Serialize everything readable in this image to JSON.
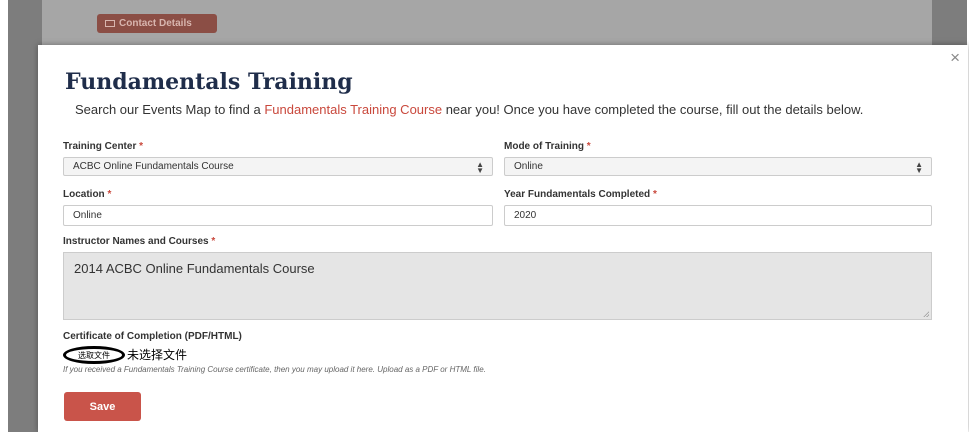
{
  "background": {
    "contact_button_label": "Contact Details"
  },
  "modal": {
    "close_glyph": "×",
    "title": "Fundamentals Training",
    "intro_before": "Search our Events Map to find a ",
    "intro_link": "Fundamentals Training Course",
    "intro_after": " near you! Once you have completed the course, fill out the details below.",
    "required_mark": "*",
    "training_center": {
      "label": "Training Center",
      "value": "ACBC Online Fundamentals Course"
    },
    "mode_of_training": {
      "label": "Mode of Training",
      "value": "Online"
    },
    "location": {
      "label": "Location",
      "value": "Online"
    },
    "year_completed": {
      "label": "Year Fundamentals Completed",
      "value": "2020"
    },
    "instructors": {
      "label": "Instructor Names and Courses",
      "value": "2014 ACBC Online Fundamentals Course"
    },
    "certificate": {
      "label": "Certificate of Completion (PDF/HTML)",
      "choose_button": "选取文件",
      "no_file": "未选择文件",
      "help": "If you received a Fundamentals Training Course certificate, then you may upload it here. Upload as a PDF or HTML file."
    },
    "save_label": "Save"
  },
  "colors": {
    "accent": "#c9544a",
    "title": "#1f2d4a",
    "overlay": "#7d7d7d"
  },
  "icons": {
    "select_arrows": "select-arrows-icon",
    "close": "close-icon",
    "contact": "id-card-icon"
  }
}
